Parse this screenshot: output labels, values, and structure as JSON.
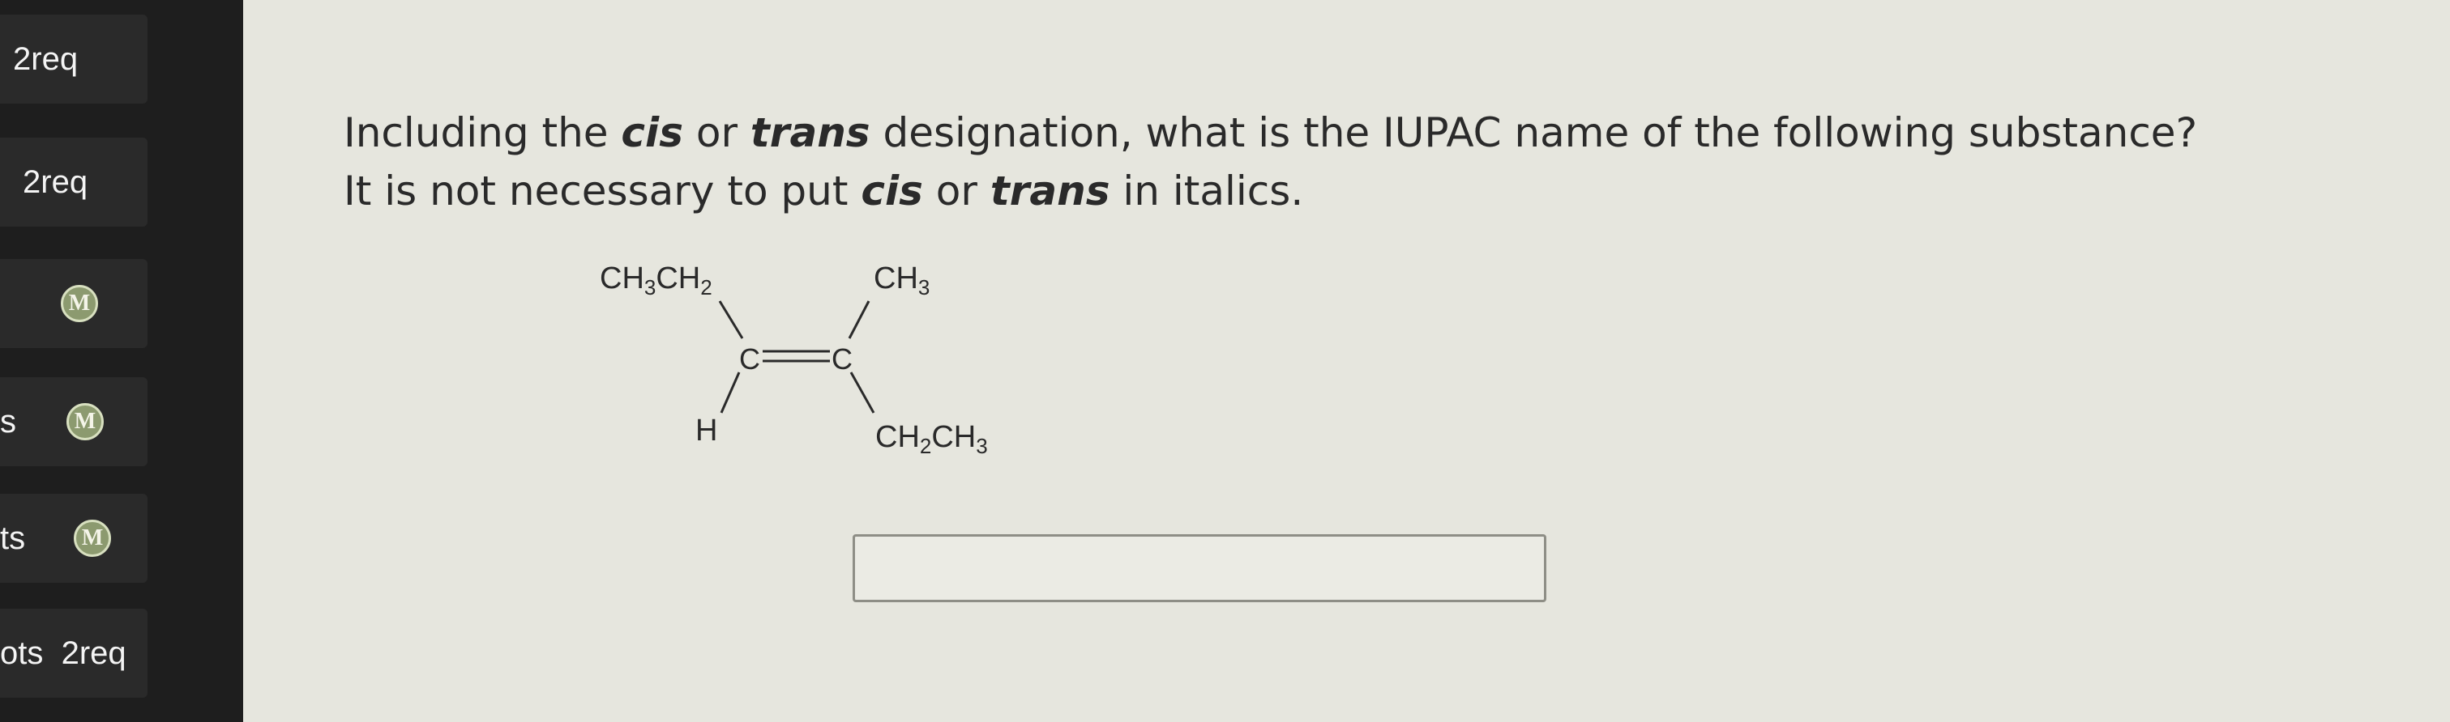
{
  "sidebar": {
    "items": [
      {
        "text": "2req",
        "badge": ""
      },
      {
        "text": "2req",
        "badge": ""
      },
      {
        "text": "",
        "badge": "M"
      },
      {
        "text": "s",
        "badge": "M"
      },
      {
        "text": "ts",
        "badge": "M"
      },
      {
        "text": "ots  2req",
        "badge": ""
      }
    ]
  },
  "question": {
    "line1_a": "Including the ",
    "line1_cis": "cis",
    "line1_b": " or ",
    "line1_trans": "trans",
    "line1_c": " designation, what is the IUPAC name of the following substance?",
    "line2_a": "It is not necessary to put ",
    "line2_cis": "cis",
    "line2_b": " or ",
    "line2_trans": "trans",
    "line2_c": " in italics."
  },
  "molecule": {
    "top_left": "CH3CH2",
    "top_right": "CH3",
    "bottom_left": "H",
    "bottom_right": "CH2CH3",
    "carbon_left": "C",
    "carbon_right": "C"
  },
  "answer": {
    "value": "",
    "placeholder": ""
  }
}
